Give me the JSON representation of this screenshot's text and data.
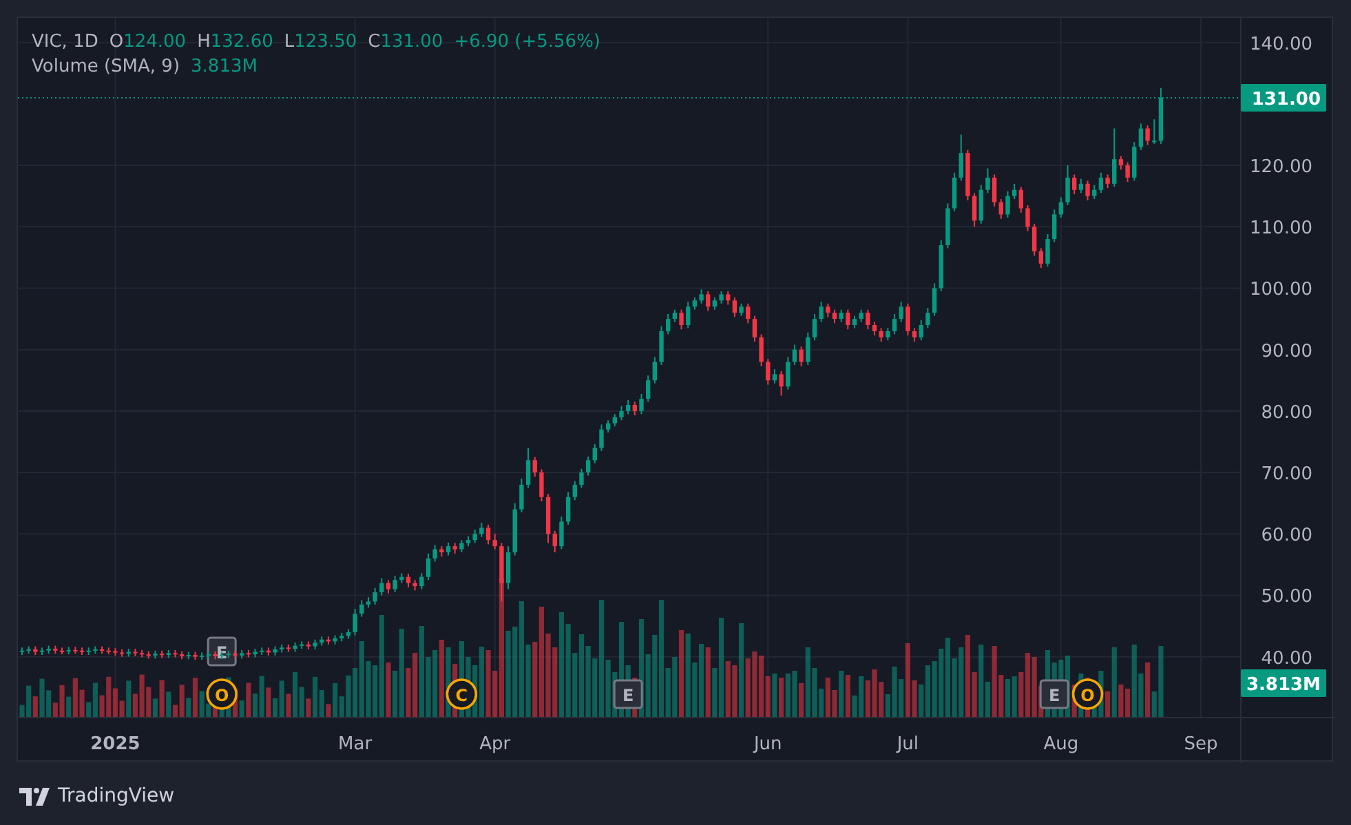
{
  "legend": {
    "symbol": "VIC, 1D",
    "ohlc": [
      {
        "label": "O",
        "value": "124.00"
      },
      {
        "label": "H",
        "value": "132.60"
      },
      {
        "label": "L",
        "value": "123.50"
      },
      {
        "label": "C",
        "value": "131.00"
      }
    ],
    "change": "+6.90 (+5.56%)"
  },
  "volume_legend": {
    "label": "Volume (SMA, 9)",
    "value": "3.813M"
  },
  "chart": {
    "chart_data": {
      "type": "candlestick",
      "grid": true,
      "ylim": [
        30.1,
        144
      ],
      "ref_lines": [
        {
          "axis": "y",
          "value": 131,
          "label": "131.00",
          "color": "#089981"
        }
      ],
      "categories": [
        null,
        null,
        null,
        null,
        null,
        null,
        null,
        null,
        null,
        null,
        null,
        null,
        null,
        null,
        "2025",
        null,
        null,
        null,
        null,
        null,
        null,
        null,
        null,
        null,
        null,
        null,
        null,
        null,
        null,
        null,
        null,
        null,
        null,
        null,
        null,
        null,
        null,
        null,
        null,
        null,
        null,
        null,
        null,
        null,
        null,
        null,
        null,
        null,
        null,
        null,
        "Mar",
        null,
        null,
        null,
        null,
        null,
        null,
        null,
        null,
        null,
        null,
        null,
        null,
        null,
        null,
        null,
        null,
        null,
        null,
        null,
        null,
        "Apr",
        null,
        null,
        null,
        null,
        null,
        null,
        null,
        null,
        null,
        null,
        null,
        null,
        null,
        null,
        null,
        null,
        null,
        null,
        null,
        null,
        null,
        null,
        null,
        null,
        null,
        null,
        null,
        null,
        null,
        null,
        null,
        null,
        null,
        null,
        null,
        null,
        null,
        null,
        null,
        null,
        "Jun",
        null,
        null,
        null,
        null,
        null,
        null,
        null,
        null,
        null,
        null,
        null,
        null,
        null,
        null,
        null,
        null,
        null,
        null,
        null,
        null,
        "Jul",
        null,
        null,
        null,
        null,
        null,
        null,
        null,
        null,
        null,
        null,
        null,
        null,
        null,
        null,
        null,
        null,
        null,
        null,
        null,
        null,
        null,
        null,
        "Aug",
        null,
        null,
        null,
        null,
        null,
        null,
        null,
        null,
        null,
        null,
        null,
        null,
        null,
        null,
        null,
        null,
        null,
        null,
        null,
        null,
        "Sep"
      ],
      "yticks": [
        {
          "value": 40,
          "label": "40.00"
        },
        {
          "value": 50,
          "label": "50.00"
        },
        {
          "value": 60,
          "label": "60.00"
        },
        {
          "value": 70,
          "label": "70.00"
        },
        {
          "value": 80,
          "label": "80.00"
        },
        {
          "value": 90,
          "label": "90.00"
        },
        {
          "value": 100,
          "label": "100.00"
        },
        {
          "value": 110,
          "label": "110.00"
        },
        {
          "value": 120,
          "label": "120.00"
        },
        {
          "value": 140,
          "label": "140.00"
        }
      ],
      "ohlc": [
        [
          40.8,
          41.5,
          40.3,
          41
        ],
        [
          41,
          41.7,
          40.5,
          41.2
        ],
        [
          41.2,
          41.7,
          40.3,
          40.8
        ],
        [
          40.8,
          41.5,
          40.3,
          41
        ],
        [
          41,
          41.8,
          40.5,
          41.3
        ],
        [
          41.3,
          41.8,
          40.5,
          41
        ],
        [
          41,
          41.5,
          40.4,
          40.9
        ],
        [
          40.9,
          41.6,
          40.4,
          41.1
        ],
        [
          41.1,
          41.6,
          40.5,
          41
        ],
        [
          41,
          41.5,
          40.3,
          40.8
        ],
        [
          40.8,
          41.5,
          40.3,
          41
        ],
        [
          41,
          41.7,
          40.5,
          41.2
        ],
        [
          41.2,
          41.7,
          40.5,
          41
        ],
        [
          41,
          41.5,
          40.4,
          40.9
        ],
        [
          40.9,
          41.4,
          40.2,
          40.7
        ],
        [
          40.7,
          41.2,
          40,
          40.5
        ],
        [
          40.5,
          41.3,
          40,
          40.8
        ],
        [
          40.8,
          41.3,
          40.1,
          40.6
        ],
        [
          40.6,
          41.1,
          39.9,
          40.4
        ],
        [
          40.4,
          40.9,
          39.7,
          40.2
        ],
        [
          40.2,
          41,
          39.7,
          40.5
        ],
        [
          40.5,
          41,
          39.8,
          40.3
        ],
        [
          40.3,
          41.1,
          39.8,
          40.6
        ],
        [
          40.6,
          41.1,
          39.9,
          40.4
        ],
        [
          40.4,
          40.9,
          39.6,
          40.1
        ],
        [
          40.1,
          40.8,
          39.6,
          40.3
        ],
        [
          40.3,
          40.8,
          39.5,
          40
        ],
        [
          40,
          40.7,
          39.5,
          40.2
        ],
        [
          40.2,
          40.9,
          39.7,
          40.4
        ],
        [
          40.4,
          40.9,
          39.6,
          40.1
        ],
        [
          40.1,
          40.8,
          39.6,
          40.3
        ],
        [
          40.3,
          41,
          39.8,
          40.5
        ],
        [
          40.5,
          41,
          39.7,
          40.2
        ],
        [
          40.2,
          41.1,
          39.7,
          40.6
        ],
        [
          40.6,
          41.1,
          39.9,
          40.4
        ],
        [
          40.4,
          41.3,
          39.9,
          40.8
        ],
        [
          40.8,
          41.5,
          40.3,
          41
        ],
        [
          41,
          41.5,
          40.2,
          40.7
        ],
        [
          40.7,
          41.7,
          40.2,
          41.2
        ],
        [
          41.2,
          42,
          40.7,
          41.5
        ],
        [
          41.5,
          42,
          40.8,
          41.3
        ],
        [
          41.3,
          42.3,
          40.8,
          41.8
        ],
        [
          41.8,
          42.5,
          41.3,
          42
        ],
        [
          42,
          42.5,
          41.2,
          41.7
        ],
        [
          41.7,
          42.8,
          41.2,
          42.3
        ],
        [
          42.3,
          43.3,
          41.8,
          42.8
        ],
        [
          42.8,
          43.3,
          42,
          42.5
        ],
        [
          42.5,
          43.5,
          42,
          43
        ],
        [
          43,
          43.9,
          42.5,
          43.4
        ],
        [
          43.4,
          44.5,
          42.9,
          44
        ],
        [
          44,
          47.8,
          43.5,
          47
        ],
        [
          47,
          49.2,
          46.5,
          48.5
        ],
        [
          48.5,
          49.7,
          48,
          49
        ],
        [
          49,
          51.2,
          48.5,
          50.5
        ],
        [
          50.5,
          52.8,
          50,
          52
        ],
        [
          52,
          52.5,
          50.3,
          51
        ],
        [
          51,
          53.2,
          50.5,
          52.5
        ],
        [
          52.5,
          53.6,
          52,
          53
        ],
        [
          53,
          53.5,
          51.3,
          52
        ],
        [
          52,
          52.5,
          50.8,
          51.5
        ],
        [
          51.5,
          53.6,
          51,
          53
        ],
        [
          53,
          56.8,
          52.5,
          56
        ],
        [
          56,
          58.2,
          55.5,
          57.5
        ],
        [
          57.5,
          58,
          56.3,
          57
        ],
        [
          57,
          58.6,
          56.5,
          58
        ],
        [
          58,
          58.5,
          56.8,
          57.5
        ],
        [
          57.5,
          59,
          57,
          58.5
        ],
        [
          58.5,
          59.6,
          58,
          59
        ],
        [
          59,
          60.7,
          58.5,
          60
        ],
        [
          60,
          61.8,
          59.5,
          61
        ],
        [
          61,
          61.5,
          58.3,
          59
        ],
        [
          59,
          60,
          57.5,
          58
        ],
        [
          58,
          58.5,
          49,
          52
        ],
        [
          52,
          58,
          51,
          57
        ],
        [
          57,
          65,
          56.5,
          64
        ],
        [
          64,
          69,
          63.5,
          68
        ],
        [
          68,
          74,
          67.5,
          72
        ],
        [
          72,
          72.5,
          69.3,
          70
        ],
        [
          70,
          70.5,
          65.3,
          66
        ],
        [
          66,
          66.5,
          58.5,
          60
        ],
        [
          60,
          60.5,
          57,
          58
        ],
        [
          58,
          62.8,
          57.5,
          62
        ],
        [
          62,
          66.8,
          61.5,
          66
        ],
        [
          66,
          68.6,
          65.5,
          68
        ],
        [
          68,
          70.6,
          67.5,
          70
        ],
        [
          70,
          72.6,
          69.5,
          72
        ],
        [
          72,
          74.6,
          71.5,
          74
        ],
        [
          74,
          77.8,
          73.5,
          77
        ],
        [
          77,
          78.5,
          76.5,
          78
        ],
        [
          78,
          79.5,
          77.5,
          79
        ],
        [
          79,
          80.8,
          78.5,
          80
        ],
        [
          80,
          81.8,
          79.5,
          81
        ],
        [
          81,
          81.5,
          79.3,
          80
        ],
        [
          80,
          82.8,
          79.5,
          82
        ],
        [
          82,
          85.8,
          81.5,
          85
        ],
        [
          85,
          88.8,
          84.5,
          88
        ],
        [
          88,
          93.8,
          87.5,
          93
        ],
        [
          93,
          95.8,
          92.5,
          95
        ],
        [
          95,
          96.5,
          94.5,
          96
        ],
        [
          96,
          96.5,
          93.3,
          94
        ],
        [
          94,
          97.8,
          93.5,
          97
        ],
        [
          97,
          98.5,
          96.5,
          98
        ],
        [
          98,
          99.8,
          97.5,
          99
        ],
        [
          99,
          99.5,
          96.3,
          97
        ],
        [
          97,
          98.5,
          96.5,
          98
        ],
        [
          98,
          99.5,
          97.5,
          99
        ],
        [
          99,
          99.5,
          97.3,
          98
        ],
        [
          98,
          98.5,
          95.3,
          96
        ],
        [
          96,
          97.5,
          95.5,
          97
        ],
        [
          97,
          97.5,
          94.3,
          95
        ],
        [
          95,
          95.5,
          91.3,
          92
        ],
        [
          92,
          92.5,
          87.3,
          88
        ],
        [
          88,
          88.5,
          84.3,
          85
        ],
        [
          85,
          86.8,
          84.5,
          86
        ],
        [
          86,
          86.5,
          82.5,
          84
        ],
        [
          84,
          88.8,
          83.5,
          88
        ],
        [
          88,
          90.8,
          87.5,
          90
        ],
        [
          90,
          90.5,
          87.3,
          88
        ],
        [
          88,
          92.8,
          87.5,
          92
        ],
        [
          92,
          95.8,
          91.5,
          95
        ],
        [
          95,
          97.8,
          94.5,
          97
        ],
        [
          97,
          97.5,
          95.3,
          96
        ],
        [
          96,
          96.5,
          94.3,
          95
        ],
        [
          95,
          96.5,
          94.5,
          96
        ],
        [
          96,
          96.5,
          93.3,
          94
        ],
        [
          94,
          95.5,
          93.5,
          95
        ],
        [
          95,
          96.5,
          94.5,
          96
        ],
        [
          96,
          96.5,
          93.3,
          94
        ],
        [
          94,
          94.5,
          92.3,
          93
        ],
        [
          93,
          93.5,
          91.3,
          92
        ],
        [
          92,
          93.5,
          91.5,
          93
        ],
        [
          93,
          95.8,
          92.5,
          95
        ],
        [
          95,
          97.8,
          94.5,
          97
        ],
        [
          97,
          97.5,
          92.3,
          93
        ],
        [
          93,
          93.5,
          91.3,
          92
        ],
        [
          92,
          94.8,
          91.5,
          94
        ],
        [
          94,
          96.8,
          93.5,
          96
        ],
        [
          96,
          100.8,
          95.5,
          100
        ],
        [
          100,
          107.8,
          99.5,
          107
        ],
        [
          107,
          113.8,
          106.5,
          113
        ],
        [
          113,
          118.8,
          112.5,
          118
        ],
        [
          118,
          125,
          117.5,
          122
        ],
        [
          122,
          122.5,
          114.3,
          115
        ],
        [
          115,
          115.5,
          110,
          111
        ],
        [
          111,
          116.8,
          110.5,
          116
        ],
        [
          116,
          119.5,
          115.5,
          118
        ],
        [
          118,
          118.5,
          113.3,
          114
        ],
        [
          114,
          114.5,
          111.3,
          112
        ],
        [
          112,
          115.8,
          111.5,
          115
        ],
        [
          115,
          117,
          114.5,
          116
        ],
        [
          116,
          116.5,
          112.3,
          113
        ],
        [
          113,
          113.5,
          109.3,
          110
        ],
        [
          110,
          110.5,
          105.3,
          106
        ],
        [
          106,
          106.5,
          103.3,
          104
        ],
        [
          104,
          108.8,
          103.5,
          108
        ],
        [
          108,
          112.8,
          107.5,
          112
        ],
        [
          112,
          114.8,
          111.5,
          114
        ],
        [
          114,
          120,
          113.5,
          118
        ],
        [
          118,
          118.5,
          115.3,
          116
        ],
        [
          116,
          117.8,
          115.5,
          117
        ],
        [
          117,
          117.5,
          114.3,
          115
        ],
        [
          115,
          116.8,
          114.5,
          116
        ],
        [
          116,
          118.8,
          115.5,
          118
        ],
        [
          118,
          118.5,
          116.3,
          117
        ],
        [
          117,
          126,
          116.5,
          121
        ],
        [
          121,
          121.5,
          119.3,
          120
        ],
        [
          120,
          120.5,
          117.3,
          118
        ],
        [
          118,
          123.8,
          117.5,
          123
        ],
        [
          123,
          126.8,
          122.5,
          126
        ],
        [
          126,
          126.5,
          123.3,
          124
        ],
        [
          124,
          127.5,
          123.5,
          124
        ],
        [
          124,
          132.6,
          123.5,
          131
        ],
        null,
        null,
        null,
        null,
        null,
        null
      ]
    }
  },
  "events": [
    {
      "kind": "box",
      "text": "E"
    },
    {
      "kind": "circle",
      "text": "O"
    },
    {
      "kind": "circle",
      "text": "C"
    },
    {
      "kind": "box",
      "text": "E"
    },
    {
      "kind": "box",
      "text": "E"
    },
    {
      "kind": "circle",
      "text": "O"
    }
  ],
  "volume_tag": "3.813M",
  "brand": "TradingView"
}
